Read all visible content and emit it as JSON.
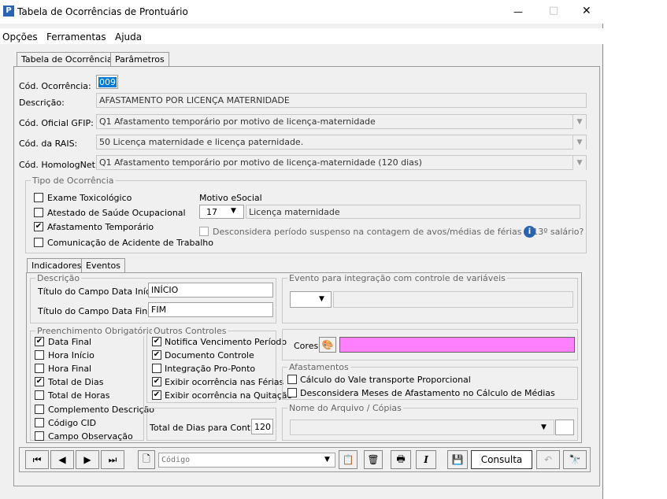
{
  "window": {
    "title": "Tabela de Ocorrências de Prontuário",
    "minimize": "—",
    "maximize": "□",
    "close": "✕"
  },
  "menu": [
    "Opções",
    "Ferramentas",
    "Ajuda"
  ],
  "main_tabs": [
    "Tabela de Ocorrências",
    "Parâmetros"
  ],
  "form": {
    "cod_ocorrencia_label": "Cód. Ocorrência:",
    "cod_ocorrencia_value": "009",
    "descricao_label": "Descrição:",
    "descricao_value": "AFASTAMENTO POR LICENÇA MATERNIDADE",
    "gfip_label": "Cód. Oficial GFIP:",
    "gfip_value": "Q1 Afastamento temporário por motivo de licença-maternidade",
    "rais_label": "Cód. da RAIS:",
    "rais_value": "50 Licença maternidade e licença paternidade.",
    "homolognet_label": "Cód. HomologNet:",
    "homolognet_value": "Q1  Afastamento temporário por motivo de licença-maternidade (120 dias)"
  },
  "tipo": {
    "title": "Tipo de Ocorrência",
    "items": [
      {
        "label": "Exame Toxicológico",
        "checked": false
      },
      {
        "label": "Atestado de Saúde Ocupacional",
        "checked": false
      },
      {
        "label": "Afastamento Temporário",
        "checked": true
      },
      {
        "label": "Comunicação de Acidente de Trabalho",
        "checked": false
      }
    ],
    "motivo_label": "Motivo eSocial",
    "motivo_code": "17",
    "motivo_desc": "Licença maternidade",
    "desconsidera_label": "Desconsidera período suspenso na contagem de avos/médias de férias e 13º salário?"
  },
  "sub_tabs": [
    "Indicadores",
    "Eventos"
  ],
  "descricao_grp": {
    "title": "Descrição",
    "inicio_label": "Título do Campo Data Início:",
    "inicio_value": "INÍCIO",
    "final_label": "Título do Campo Data Final:",
    "final_value": "FIM"
  },
  "evento_grp": {
    "title": "Evento para integração com controle de variáveis"
  },
  "preench": {
    "title": "Preenchimento Obrigatório",
    "items": [
      {
        "label": "Data Final",
        "checked": true
      },
      {
        "label": "Hora Início",
        "checked": false
      },
      {
        "label": "Hora Final",
        "checked": false
      },
      {
        "label": "Total de Dias",
        "checked": true
      },
      {
        "label": "Total de Horas",
        "checked": false
      },
      {
        "label": "Complemento Descrição",
        "checked": false
      },
      {
        "label": "Código CID",
        "checked": false
      },
      {
        "label": "Campo Observação",
        "checked": false
      }
    ]
  },
  "outros": {
    "title": "Outros Controles",
    "items": [
      {
        "label": "Notifica Vencimento Período",
        "checked": true
      },
      {
        "label": "Documento Controle",
        "checked": true
      },
      {
        "label": "Integração Pro-Ponto",
        "checked": false
      },
      {
        "label": "Exibir ocorrência nas Férias",
        "checked": true
      },
      {
        "label": "Exibir ocorrência na Quitação",
        "checked": true
      }
    ],
    "total_label": "Total de Dias para Controle:",
    "total_value": "120"
  },
  "cores": {
    "label": "Cores",
    "color": "#ff80ff"
  },
  "afast": {
    "title": "Afastamentos",
    "items": [
      {
        "label": "Cálculo do Vale transporte Proporcional",
        "checked": false
      },
      {
        "label": "Desconsidera Meses de Afastamento no Cálculo de Médias",
        "checked": false
      }
    ]
  },
  "arquivo": {
    "title": "Nome do Arquivo / Cópias"
  },
  "toolbar": {
    "first": "⏮",
    "prev": "◀",
    "next": "▶",
    "last": "⏭",
    "search_placeholder": "Código",
    "consulta": "Consulta",
    "italic": "I"
  },
  "icons": {
    "app": "app-icon",
    "info": "info-icon"
  }
}
